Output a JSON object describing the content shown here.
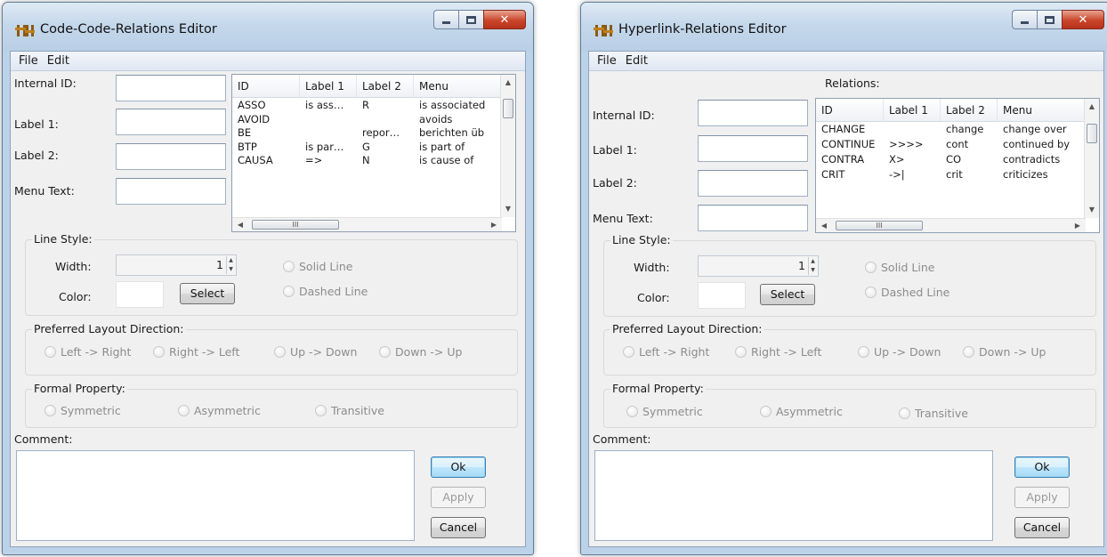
{
  "windows": [
    {
      "title": "Code-Code-Relations Editor",
      "menu": [
        "File",
        "Edit"
      ],
      "relations_caption": "",
      "fields": {
        "internal_id_label": "Internal ID:",
        "label1_label": "Label 1:",
        "label2_label": "Label 2:",
        "menu_text_label": "Menu Text:"
      },
      "table": {
        "columns": [
          "ID",
          "Label 1",
          "Label 2",
          "Menu"
        ],
        "rows": [
          [
            "ASSO",
            "is ass…",
            "R",
            "is associated"
          ],
          [
            "AVOID",
            "",
            "",
            "avoids"
          ],
          [
            "BE",
            "",
            "repor…",
            "berichten üb"
          ],
          [
            "BTP",
            "is par…",
            "G",
            "is part of"
          ],
          [
            "CAUSA",
            "=>",
            "N",
            "is cause of"
          ]
        ],
        "scroll_marker": "III"
      },
      "line_style": {
        "title": "Line Style:",
        "width_label": "Width:",
        "width_value": "1",
        "color_label": "Color:",
        "select_button": "Select",
        "solid": "Solid Line",
        "dashed": "Dashed Line"
      },
      "layout_direction": {
        "title": "Preferred Layout Direction:",
        "options": [
          "Left -> Right",
          "Right -> Left",
          "Up -> Down",
          "Down -> Up"
        ]
      },
      "formal_property": {
        "title": "Formal Property:",
        "options": [
          "Symmetric",
          "Asymmetric",
          "Transitive"
        ]
      },
      "comment_label": "Comment:",
      "buttons": {
        "ok": "Ok",
        "apply": "Apply",
        "cancel": "Cancel"
      }
    },
    {
      "title": "Hyperlink-Relations Editor",
      "menu": [
        "File",
        "Edit"
      ],
      "relations_caption": "Relations:",
      "fields": {
        "internal_id_label": "Internal ID:",
        "label1_label": "Label 1:",
        "label2_label": "Label 2:",
        "menu_text_label": "Menu Text:"
      },
      "table": {
        "columns": [
          "ID",
          "Label 1",
          "Label 2",
          "Menu"
        ],
        "rows": [
          [
            "CHANGE",
            "",
            "change",
            "change over"
          ],
          [
            "CONTINUE",
            ">>>>",
            "cont",
            "continued by"
          ],
          [
            "CONTRA",
            "X>",
            "CO",
            "contradicts"
          ],
          [
            "CRIT",
            "->|",
            "crit",
            "criticizes"
          ]
        ],
        "scroll_marker": "III"
      },
      "line_style": {
        "title": "Line Style:",
        "width_label": "Width:",
        "width_value": "1",
        "color_label": "Color:",
        "select_button": "Select",
        "solid": "Solid Line",
        "dashed": "Dashed Line"
      },
      "layout_direction": {
        "title": "Preferred Layout Direction:",
        "options": [
          "Left -> Right",
          "Right -> Left",
          "Up -> Down",
          "Down -> Up"
        ]
      },
      "formal_property": {
        "title": "Formal Property:",
        "options": [
          "Symmetric",
          "Asymmetric",
          "Transitive"
        ]
      },
      "comment_label": "Comment:",
      "buttons": {
        "ok": "Ok",
        "apply": "Apply",
        "cancel": "Cancel"
      }
    }
  ]
}
